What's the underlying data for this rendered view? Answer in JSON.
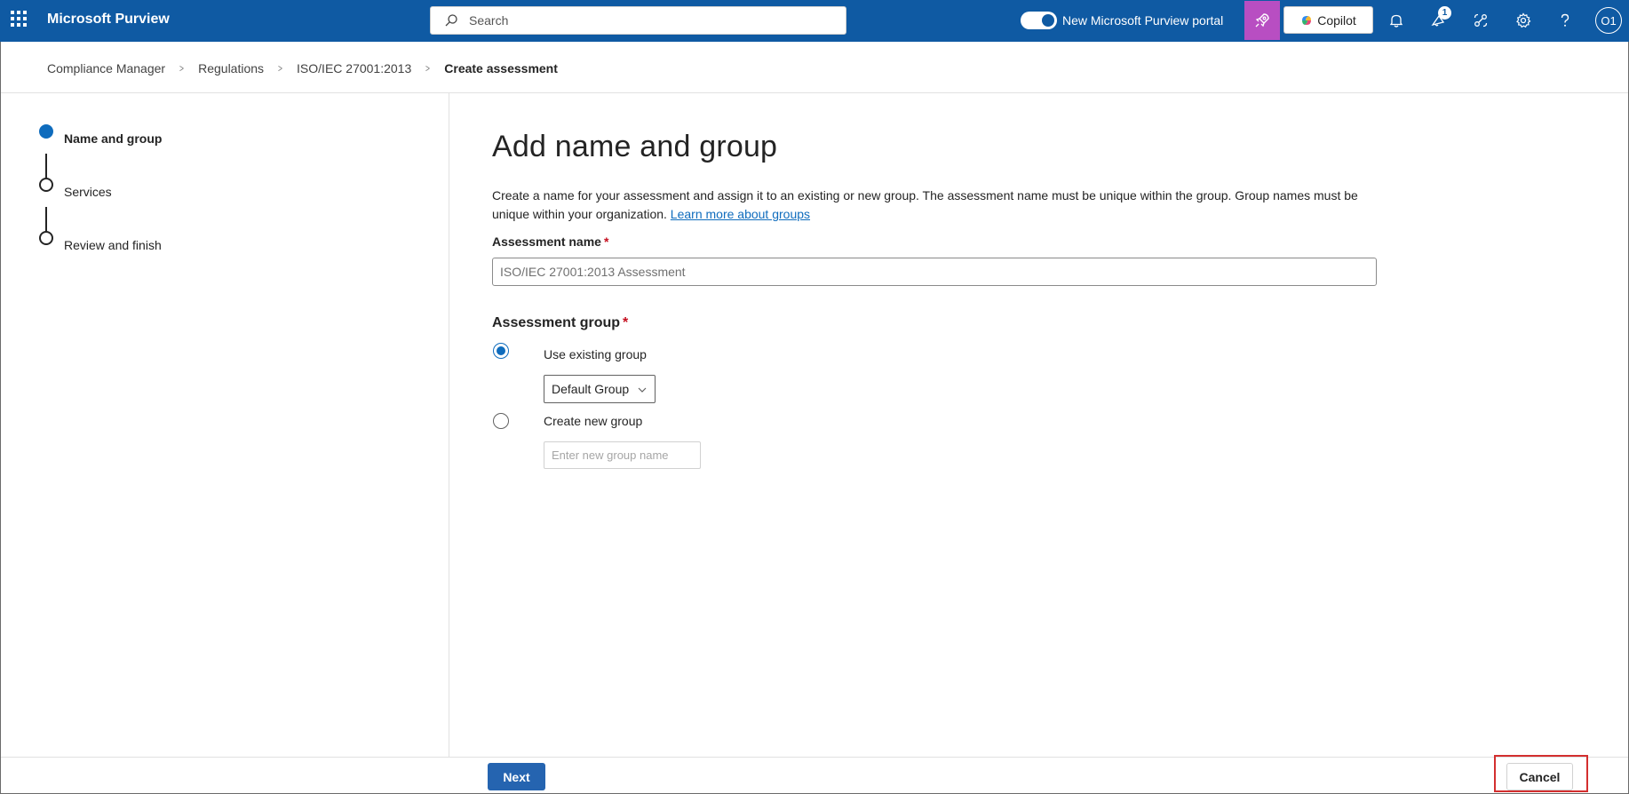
{
  "topbar": {
    "brand": "Microsoft Purview",
    "search_placeholder": "Search",
    "portal_toggle_label": "New Microsoft Purview portal",
    "portal_toggle_on": true,
    "copilot_label": "Copilot",
    "notification_badge": "1",
    "avatar_initials": "O1",
    "bar_color": "#0f5aa3",
    "accent_color": "#b84ec2"
  },
  "breadcrumb": {
    "items": [
      "Compliance Manager",
      "Regulations",
      "ISO/IEC 27001:2013"
    ],
    "current": "Create assessment"
  },
  "steps": [
    {
      "label": "Name and group",
      "active": true
    },
    {
      "label": "Services",
      "active": false
    },
    {
      "label": "Review and finish",
      "active": false
    }
  ],
  "main": {
    "title": "Add name and group",
    "description": "Create a name for your assessment and assign it to an existing or new group. The assessment name must be unique within the group. Group names must be unique within your organization.",
    "learn_more_link": "Learn more about groups",
    "assessment_name_label": "Assessment name",
    "assessment_name_placeholder": "ISO/IEC 27001:2013 Assessment",
    "required_mark": "*",
    "assessment_group_label": "Assessment group",
    "use_existing_label": "Use existing group",
    "use_existing_checked": true,
    "existing_group_value": "Default Group",
    "create_new_label": "Create new group",
    "create_new_checked": false,
    "new_group_placeholder": "Enter new group name"
  },
  "footer": {
    "next_label": "Next",
    "cancel_label": "Cancel"
  }
}
